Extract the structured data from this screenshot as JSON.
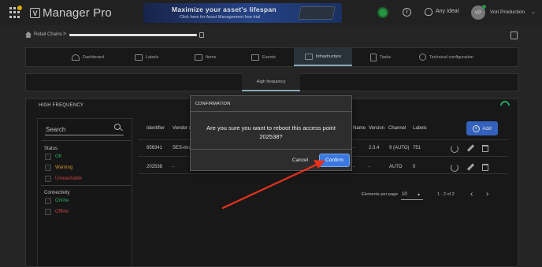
{
  "app": {
    "brand": "Manager Pro",
    "logo_letter": "V"
  },
  "banner": {
    "headline": "Maximize your asset's lifespan",
    "subline": "Click here for Asset Management free trial"
  },
  "header": {
    "idea_label": "Any Ideal",
    "avatar_initials": "VP",
    "user_name": "Vori Production",
    "status_color": "#2ca84a"
  },
  "breadcrumb": {
    "root": "Retail Chains",
    "separator": ">"
  },
  "tabs": [
    {
      "label": "Dashboard"
    },
    {
      "label": "Labels"
    },
    {
      "label": "Items"
    },
    {
      "label": "Events"
    },
    {
      "label": "Infrastructure"
    },
    {
      "label": "Tasks"
    },
    {
      "label": "Technical configuration"
    }
  ],
  "subtab": {
    "label": "High frequency"
  },
  "panel": {
    "title": "HIGH FREQUENCY"
  },
  "filters": {
    "search_label": "Search",
    "status_label": "Status",
    "status_options": [
      {
        "label": "OK",
        "color": "#2fbf71"
      },
      {
        "label": "Warning",
        "color": "#f0a030"
      },
      {
        "label": "Unreachable",
        "color": "#e24b4b"
      }
    ],
    "connectivity_label": "Connectivity",
    "connectivity_options": [
      {
        "label": "Online",
        "color": "#2fbf71"
      },
      {
        "label": "Offline",
        "color": "#e24b4b"
      }
    ]
  },
  "table": {
    "headers": {
      "identifier": "Identifier",
      "vendor": "Vendor &",
      "name": "Name",
      "version": "Version",
      "channel": "Channel",
      "labels": "Labels"
    },
    "add_label": "Add",
    "rows": [
      {
        "identifier": "656341",
        "vendor": "SES-ima",
        "name": "-",
        "version": "2.3.4",
        "channel": "9 (AUTO)",
        "labels": "751"
      },
      {
        "identifier": "202538",
        "vendor": "-",
        "name": "-",
        "version": "-",
        "channel": "AUTO",
        "labels": "0"
      }
    ]
  },
  "pagination": {
    "per_page_label": "Elements per page",
    "per_page_value": "10",
    "range": "1 - 2 of 2"
  },
  "dialog": {
    "title": "CONFIRMATION",
    "line1": "Are you sure you want to reboot this access point",
    "line2": "202538?",
    "cancel": "Cancel",
    "confirm": "Confirm"
  }
}
